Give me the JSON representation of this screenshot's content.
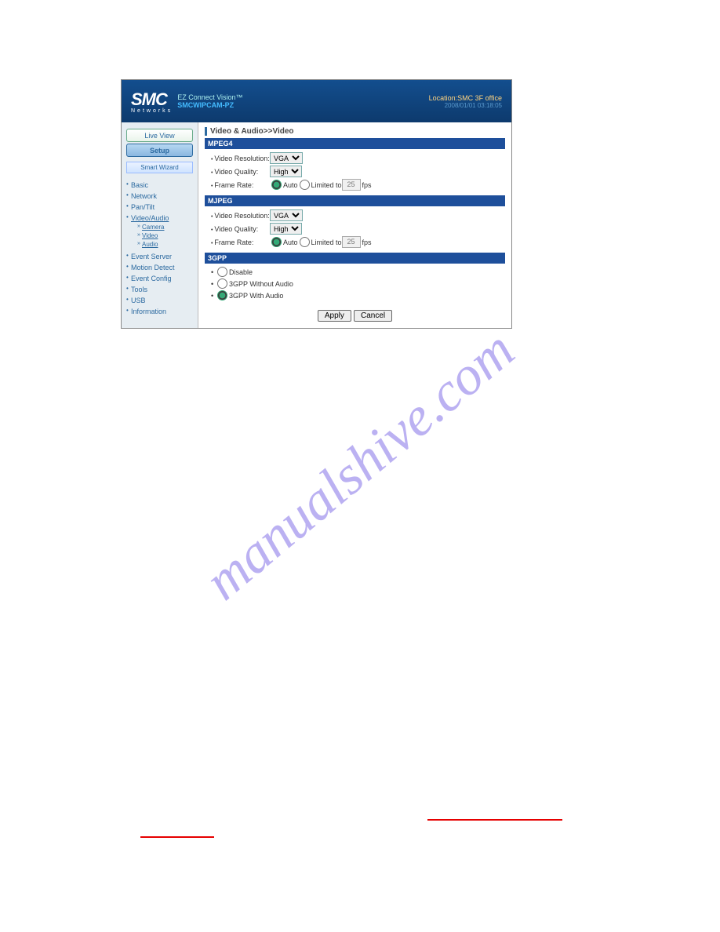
{
  "header": {
    "brand": "SMC",
    "brand_sub": "Networks",
    "product_line": "EZ Connect Vision™",
    "product_model": "SMCWIPCAM-PZ",
    "location": "Location:SMC 3F office",
    "datetime": "2008/01/01 03:18:05"
  },
  "sidebar": {
    "live_view": "Live View",
    "setup": "Setup",
    "smart_wizard": "Smart Wizard",
    "items": [
      {
        "label": "Basic"
      },
      {
        "label": "Network"
      },
      {
        "label": "Pan/Tilt"
      },
      {
        "label": "Video/Audio",
        "active": true,
        "sub": [
          {
            "label": "Camera"
          },
          {
            "label": "Video"
          },
          {
            "label": "Audio"
          }
        ]
      },
      {
        "label": "Event Server"
      },
      {
        "label": "Motion Detect"
      },
      {
        "label": "Event Config"
      },
      {
        "label": "Tools"
      },
      {
        "label": "USB"
      },
      {
        "label": "Information"
      }
    ]
  },
  "main": {
    "breadcrumb": "Video & Audio>>Video",
    "sections": {
      "mpeg4": {
        "title": "MPEG4",
        "res_label": "Video Resolution:",
        "res_value": "VGA",
        "quality_label": "Video Quality:",
        "quality_value": "High",
        "fps_label": "Frame Rate:",
        "auto": "Auto",
        "limited": "Limited to",
        "fps_value": "25",
        "fps_unit": "fps"
      },
      "mjpeg": {
        "title": "MJPEG",
        "res_label": "Video Resolution:",
        "res_value": "VGA",
        "quality_label": "Video Quality:",
        "quality_value": "High",
        "fps_label": "Frame Rate:",
        "auto": "Auto",
        "limited": "Limited to",
        "fps_value": "25",
        "fps_unit": "fps"
      },
      "gpp": {
        "title": "3GPP",
        "opt_disable": "Disable",
        "opt_without": "3GPP Without Audio",
        "opt_with": "3GPP With Audio"
      }
    },
    "apply": "Apply",
    "cancel": "Cancel"
  },
  "watermark": "manualshive.com"
}
